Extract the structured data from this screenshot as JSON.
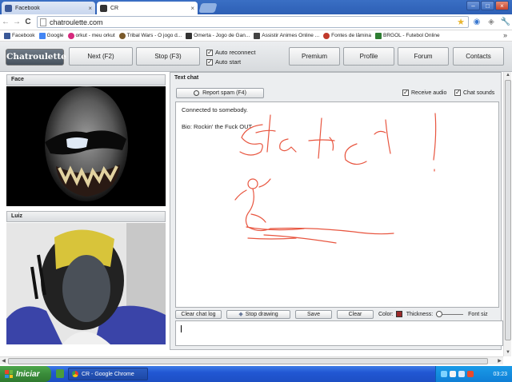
{
  "browser": {
    "tabs": [
      {
        "title": "Facebook",
        "close": "×",
        "favicon_color": "#3b5998"
      },
      {
        "title": "CR",
        "close": "×",
        "favicon_color": "#333333"
      }
    ],
    "window_controls": {
      "minimize": "–",
      "maximize": "□",
      "close": "×"
    },
    "address_bar": {
      "url": "chatroulette.com"
    },
    "nav": {
      "back": "←",
      "forward": "→",
      "reload": "C"
    },
    "bookmarks": [
      {
        "label": "Facebook",
        "icon_color": "#3b5998"
      },
      {
        "label": "Google",
        "icon_color": "#4285f4"
      },
      {
        "label": "orkut - meu orkut",
        "icon_color": "#d6297d"
      },
      {
        "label": "Tribal Wars - O jogo d...",
        "icon_color": "#7a5a2b"
      },
      {
        "label": "Omerta - Jogo de Gan...",
        "icon_color": "#333333"
      },
      {
        "label": "Assistir Animes Online ...",
        "icon_color": "#444444"
      },
      {
        "label": "Fontes de lâmina",
        "icon_color": "#c0392b"
      },
      {
        "label": "BRGOL - Futebol Online",
        "icon_color": "#2e7d32"
      }
    ],
    "bookmarks_more": "»"
  },
  "chatroulette": {
    "logo": "Chatroulette",
    "buttons": {
      "next": "Next (F2)",
      "stop": "Stop (F3)",
      "premium": "Premium",
      "profile": "Profile",
      "forum": "Forum",
      "contacts": "Contacts"
    },
    "options": {
      "auto_reconnect": "Auto reconnect",
      "auto_start": "Auto start",
      "auto_reconnect_checked": true,
      "auto_start_checked": true
    },
    "panels": {
      "stranger_label": "Face",
      "self_label": "Luiz"
    },
    "text_chat": {
      "title": "Text chat",
      "report_spam": "Report spam (F4)",
      "receive_audio": "Receive audio",
      "chat_sounds": "Chat sounds",
      "receive_audio_checked": true,
      "chat_sounds_checked": true,
      "messages": [
        "Connected to somebody.",
        "Bio: Rockin' the Fuck OUT"
      ],
      "controls": {
        "clear_chat_log": "Clear chat log",
        "stop_drawing": "Stop drawing",
        "save": "Save",
        "clear": "Clear",
        "color_label": "Color:",
        "thickness_label": "Thickness:",
        "font_size_label": "Font siz"
      },
      "draw_color": "#e8553f"
    }
  },
  "taskbar": {
    "start": "Iniciar",
    "task": "CR - Google Chrome",
    "clock": "03:23"
  }
}
